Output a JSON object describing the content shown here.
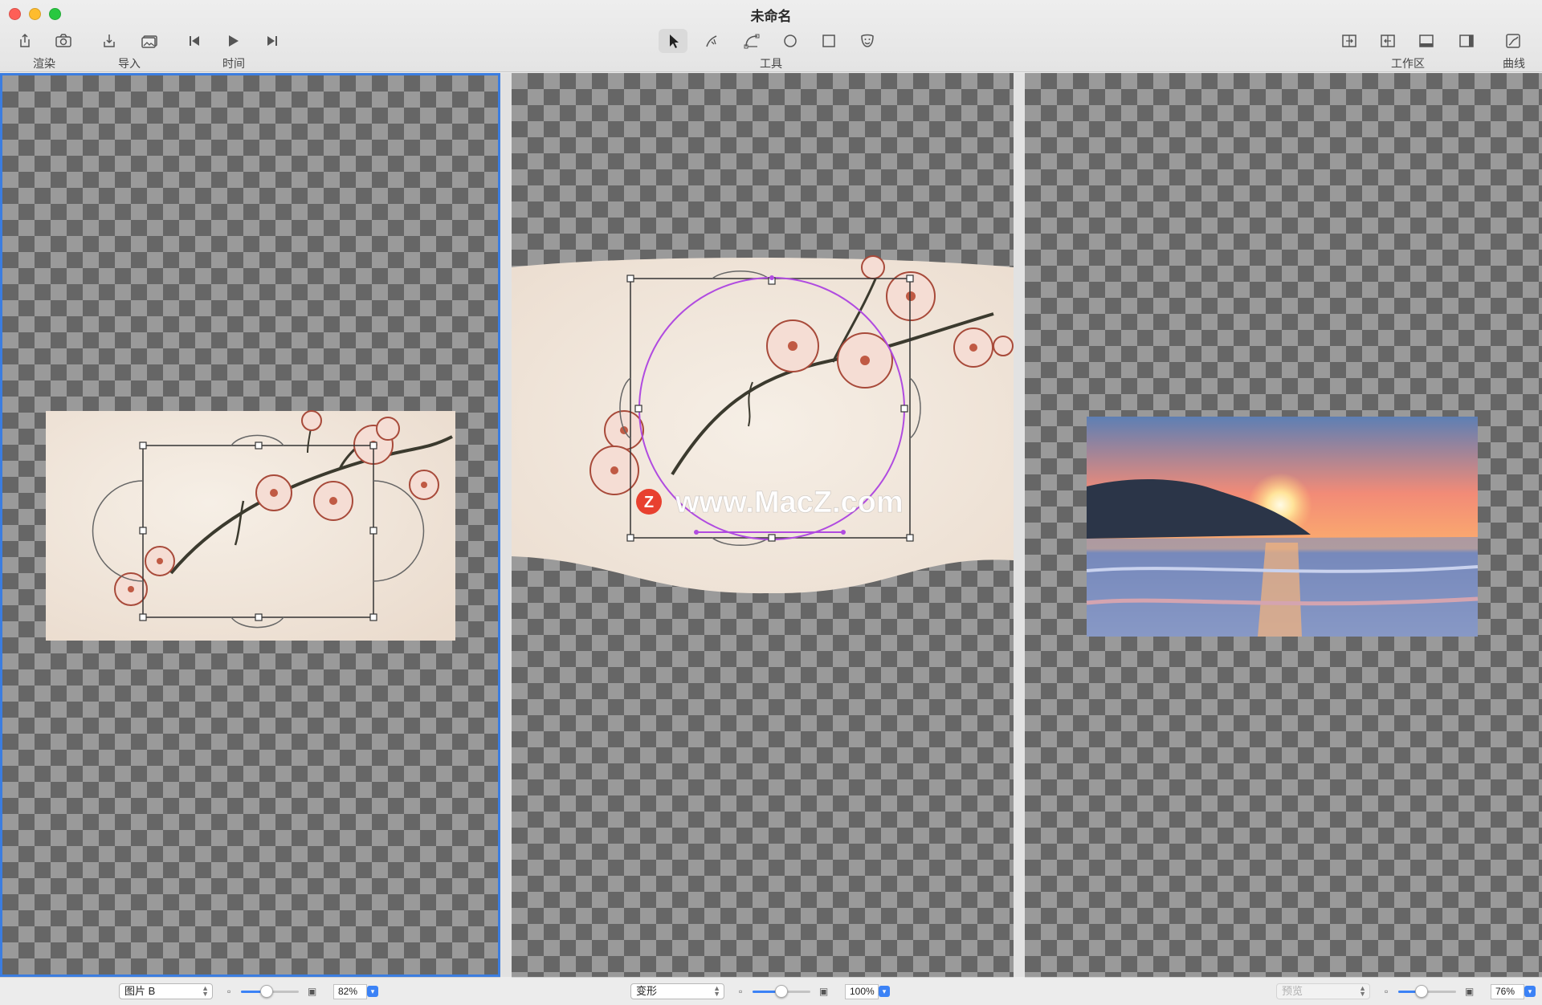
{
  "window": {
    "title": "未命名"
  },
  "toolbar": {
    "render_label": "渲染",
    "import_label": "导入",
    "time_label": "时间",
    "tools_label": "工具",
    "workspace_label": "工作区",
    "curve_label": "曲线"
  },
  "left_panel": {
    "image_select": "图片 B",
    "zoom": "82%",
    "zoom_level": 0.45
  },
  "middle_panel": {
    "mode_select": "变形",
    "zoom": "100%",
    "zoom_level": 0.5,
    "watermark": "www.MacZ.com",
    "watermark_logo": "Z"
  },
  "right_panel": {
    "preview_select": "预览",
    "zoom": "76%",
    "zoom_level": 0.4
  },
  "colors": {
    "accent": "#3b82f6",
    "selection_border": "#3b7de0",
    "morph_circle": "#b04be0"
  }
}
